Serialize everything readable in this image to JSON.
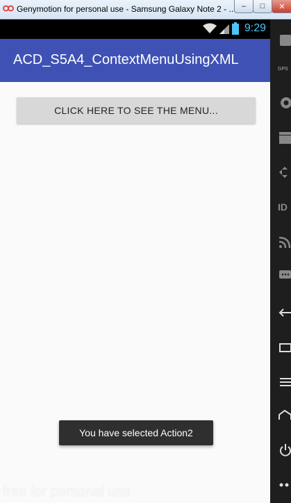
{
  "window": {
    "title": "Genymotion for personal use - Samsung Galaxy Note 2 - ...",
    "min_glyph": "–",
    "max_glyph": "□",
    "close_glyph": "✕"
  },
  "status_bar": {
    "time": "9:29",
    "time_color": "#4fc3f7"
  },
  "app_bar": {
    "title": "ACD_S5A4_ContextMenuUsingXML",
    "color": "#3f51b5"
  },
  "main": {
    "button_label": "CLICK HERE TO SEE THE MENU..."
  },
  "toast": {
    "text": "You have selected Action2"
  },
  "watermark": {
    "text": "free for personal use"
  },
  "sidebar": {
    "icons": [
      "battery-icon",
      "gps-icon",
      "camera-icon",
      "clapperboard-icon",
      "dpad-icon",
      "id-icon",
      "wifi-icon",
      "sms-icon",
      "back-icon",
      "recent-apps-icon",
      "menu-icon",
      "home-icon",
      "power-icon",
      "more-icon"
    ],
    "labels": {
      "gps": "GPS",
      "id": "ID"
    }
  }
}
